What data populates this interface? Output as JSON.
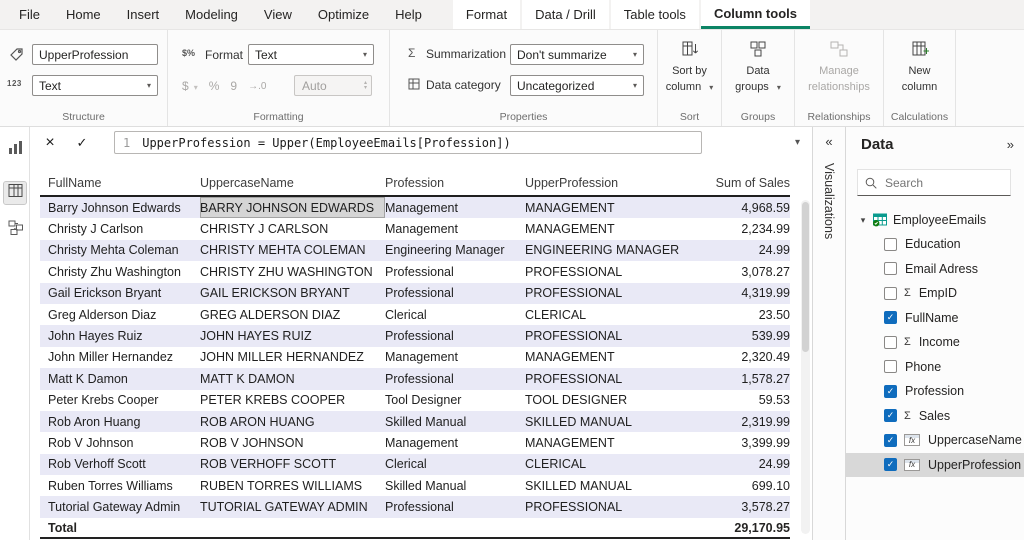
{
  "icons": {
    "cancel": "×",
    "check": "✓",
    "caret": "▾",
    "spin_up": "▴",
    "spin_down": "▾",
    "collapse": "«",
    "expand": "»",
    "sigma": "Σ",
    "fx": "fx",
    "tag_glyph": "123",
    "format_glyph": "$%",
    "currency": "$",
    "percent": "%",
    "thousands": "9",
    "decimals": "→.0"
  },
  "menubar": {
    "tabs": [
      {
        "label": "File"
      },
      {
        "label": "Home"
      },
      {
        "label": "Insert"
      },
      {
        "label": "Modeling"
      },
      {
        "label": "View"
      },
      {
        "label": "Optimize"
      },
      {
        "label": "Help"
      },
      {
        "label": "Format",
        "contextual": true
      },
      {
        "label": "Data / Drill",
        "contextual": true
      },
      {
        "label": "Table tools",
        "contextual": true
      },
      {
        "label": "Column tools",
        "contextual": true,
        "active": true
      }
    ]
  },
  "ribbon": {
    "structure": {
      "label": "Structure",
      "name_value": "UpperProfession",
      "datatype_value": "Text"
    },
    "formatting": {
      "label": "Formatting",
      "format_label": "Format",
      "format_value": "Text",
      "auto_value": "Auto"
    },
    "properties": {
      "label": "Properties",
      "summarization_label": "Summarization",
      "summarization_value": "Don't summarize",
      "datacategory_label": "Data category",
      "datacategory_value": "Uncategorized"
    },
    "sort": {
      "label": "Sort",
      "line1": "Sort by",
      "line2": "column"
    },
    "groups": {
      "label": "Groups",
      "line1": "Data",
      "line2": "groups"
    },
    "relationships": {
      "label": "Relationships",
      "line1": "Manage",
      "line2": "relationships"
    },
    "calculations": {
      "label": "Calculations",
      "line1": "New",
      "line2": "column"
    }
  },
  "formula_bar": {
    "line_number": "1",
    "formula": "UpperProfession = Upper(EmployeeEmails[Profession])"
  },
  "table": {
    "columns": [
      "FullName",
      "UppercaseName",
      "Profession",
      "UpperProfession",
      "Sum of Sales"
    ],
    "selected_cell": {
      "row": 0,
      "col": 1
    },
    "rows": [
      [
        "Barry Johnson Edwards",
        "BARRY JOHNSON EDWARDS",
        "Management",
        "MANAGEMENT",
        "4,968.59"
      ],
      [
        "Christy J Carlson",
        "CHRISTY J CARLSON",
        "Management",
        "MANAGEMENT",
        "2,234.99"
      ],
      [
        "Christy Mehta Coleman",
        "CHRISTY MEHTA COLEMAN",
        "Engineering Manager",
        "ENGINEERING MANAGER",
        "24.99"
      ],
      [
        "Christy Zhu Washington",
        "CHRISTY ZHU WASHINGTON",
        "Professional",
        "PROFESSIONAL",
        "3,078.27"
      ],
      [
        "Gail Erickson Bryant",
        "GAIL ERICKSON BRYANT",
        "Professional",
        "PROFESSIONAL",
        "4,319.99"
      ],
      [
        "Greg Alderson Diaz",
        "GREG ALDERSON DIAZ",
        "Clerical",
        "CLERICAL",
        "23.50"
      ],
      [
        "John Hayes Ruiz",
        "JOHN HAYES RUIZ",
        "Professional",
        "PROFESSIONAL",
        "539.99"
      ],
      [
        "John Miller Hernandez",
        "JOHN MILLER HERNANDEZ",
        "Management",
        "MANAGEMENT",
        "2,320.49"
      ],
      [
        "Matt K Damon",
        "MATT K DAMON",
        "Professional",
        "PROFESSIONAL",
        "1,578.27"
      ],
      [
        "Peter Krebs Cooper",
        "PETER KREBS COOPER",
        "Tool Designer",
        "TOOL DESIGNER",
        "59.53"
      ],
      [
        "Rob Aron Huang",
        "ROB ARON HUANG",
        "Skilled Manual",
        "SKILLED MANUAL",
        "2,319.99"
      ],
      [
        "Rob V Johnson",
        "ROB V JOHNSON",
        "Management",
        "MANAGEMENT",
        "3,399.99"
      ],
      [
        "Rob Verhoff Scott",
        "ROB VERHOFF SCOTT",
        "Clerical",
        "CLERICAL",
        "24.99"
      ],
      [
        "Ruben Torres Williams",
        "RUBEN TORRES WILLIAMS",
        "Skilled Manual",
        "SKILLED MANUAL",
        "699.10"
      ],
      [
        "Tutorial Gateway Admin",
        "TUTORIAL GATEWAY ADMIN",
        "Professional",
        "PROFESSIONAL",
        "3,578.27"
      ]
    ],
    "total_label": "Total",
    "total_value": "29,170.95"
  },
  "panels": {
    "visualizations_title": "Visualizations",
    "data": {
      "title": "Data",
      "search_placeholder": "Search",
      "table_name": "EmployeeEmails",
      "fields": [
        {
          "name": "Education",
          "checked": false,
          "icon": "none"
        },
        {
          "name": "Email Adress",
          "checked": false,
          "icon": "none"
        },
        {
          "name": "EmpID",
          "checked": false,
          "icon": "sigma"
        },
        {
          "name": "FullName",
          "checked": true,
          "icon": "none"
        },
        {
          "name": "Income",
          "checked": false,
          "icon": "sigma"
        },
        {
          "name": "Phone",
          "checked": false,
          "icon": "none"
        },
        {
          "name": "Profession",
          "checked": true,
          "icon": "none"
        },
        {
          "name": "Sales",
          "checked": true,
          "icon": "sigma"
        },
        {
          "name": "UppercaseName",
          "checked": true,
          "icon": "fx"
        },
        {
          "name": "UpperProfession",
          "checked": true,
          "icon": "fx",
          "selected": true
        }
      ]
    }
  }
}
